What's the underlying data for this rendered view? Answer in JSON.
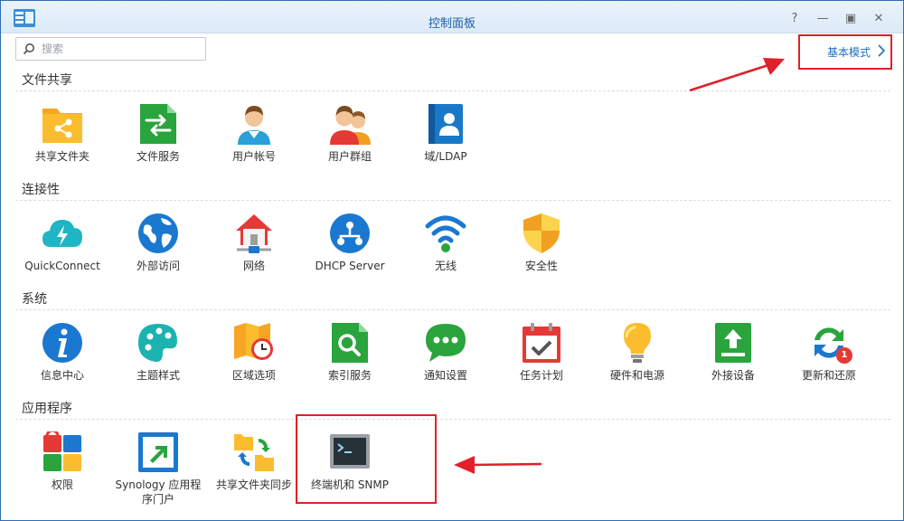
{
  "window": {
    "title": "控制面板"
  },
  "titlebar_controls": {
    "help": "?",
    "minimize": "—",
    "maximize": "▣",
    "close": "✕"
  },
  "search": {
    "placeholder": "搜索"
  },
  "mode_link": {
    "label": "基本模式"
  },
  "sections": [
    {
      "title": "文件共享",
      "items": [
        {
          "label": "共享文件夹",
          "icon": "shared-folder-icon"
        },
        {
          "label": "文件服务",
          "icon": "file-services-icon"
        },
        {
          "label": "用户帐号",
          "icon": "user-icon"
        },
        {
          "label": "用户群组",
          "icon": "group-icon"
        },
        {
          "label": "域/LDAP",
          "icon": "domain-ldap-icon"
        }
      ]
    },
    {
      "title": "连接性",
      "items": [
        {
          "label": "QuickConnect",
          "icon": "quickconnect-icon"
        },
        {
          "label": "外部访问",
          "icon": "external-access-icon"
        },
        {
          "label": "网络",
          "icon": "network-icon"
        },
        {
          "label": "DHCP Server",
          "icon": "dhcp-server-icon"
        },
        {
          "label": "无线",
          "icon": "wireless-icon"
        },
        {
          "label": "安全性",
          "icon": "security-icon"
        }
      ]
    },
    {
      "title": "系统",
      "items": [
        {
          "label": "信息中心",
          "icon": "info-center-icon"
        },
        {
          "label": "主题样式",
          "icon": "theme-icon"
        },
        {
          "label": "区域选项",
          "icon": "regional-options-icon"
        },
        {
          "label": "索引服务",
          "icon": "indexing-service-icon"
        },
        {
          "label": "通知设置",
          "icon": "notification-icon"
        },
        {
          "label": "任务计划",
          "icon": "task-scheduler-icon"
        },
        {
          "label": "硬件和电源",
          "icon": "hardware-power-icon"
        },
        {
          "label": "外接设备",
          "icon": "external-devices-icon"
        },
        {
          "label": "更新和还原",
          "icon": "update-restore-icon",
          "badge": "1"
        }
      ]
    },
    {
      "title": "应用程序",
      "items": [
        {
          "label": "权限",
          "icon": "privileges-icon"
        },
        {
          "label": "Synology 应用程序门户",
          "label_line1": "Synology 应用程",
          "label_line2": "序门户",
          "icon": "application-portal-icon"
        },
        {
          "label": "共享文件夹同步",
          "icon": "shared-folder-sync-icon"
        },
        {
          "label": "终端机和 SNMP",
          "icon": "terminal-snmp-icon"
        }
      ]
    }
  ],
  "colors": {
    "accent": "#1e6ec2",
    "highlight": "#e0202a"
  }
}
